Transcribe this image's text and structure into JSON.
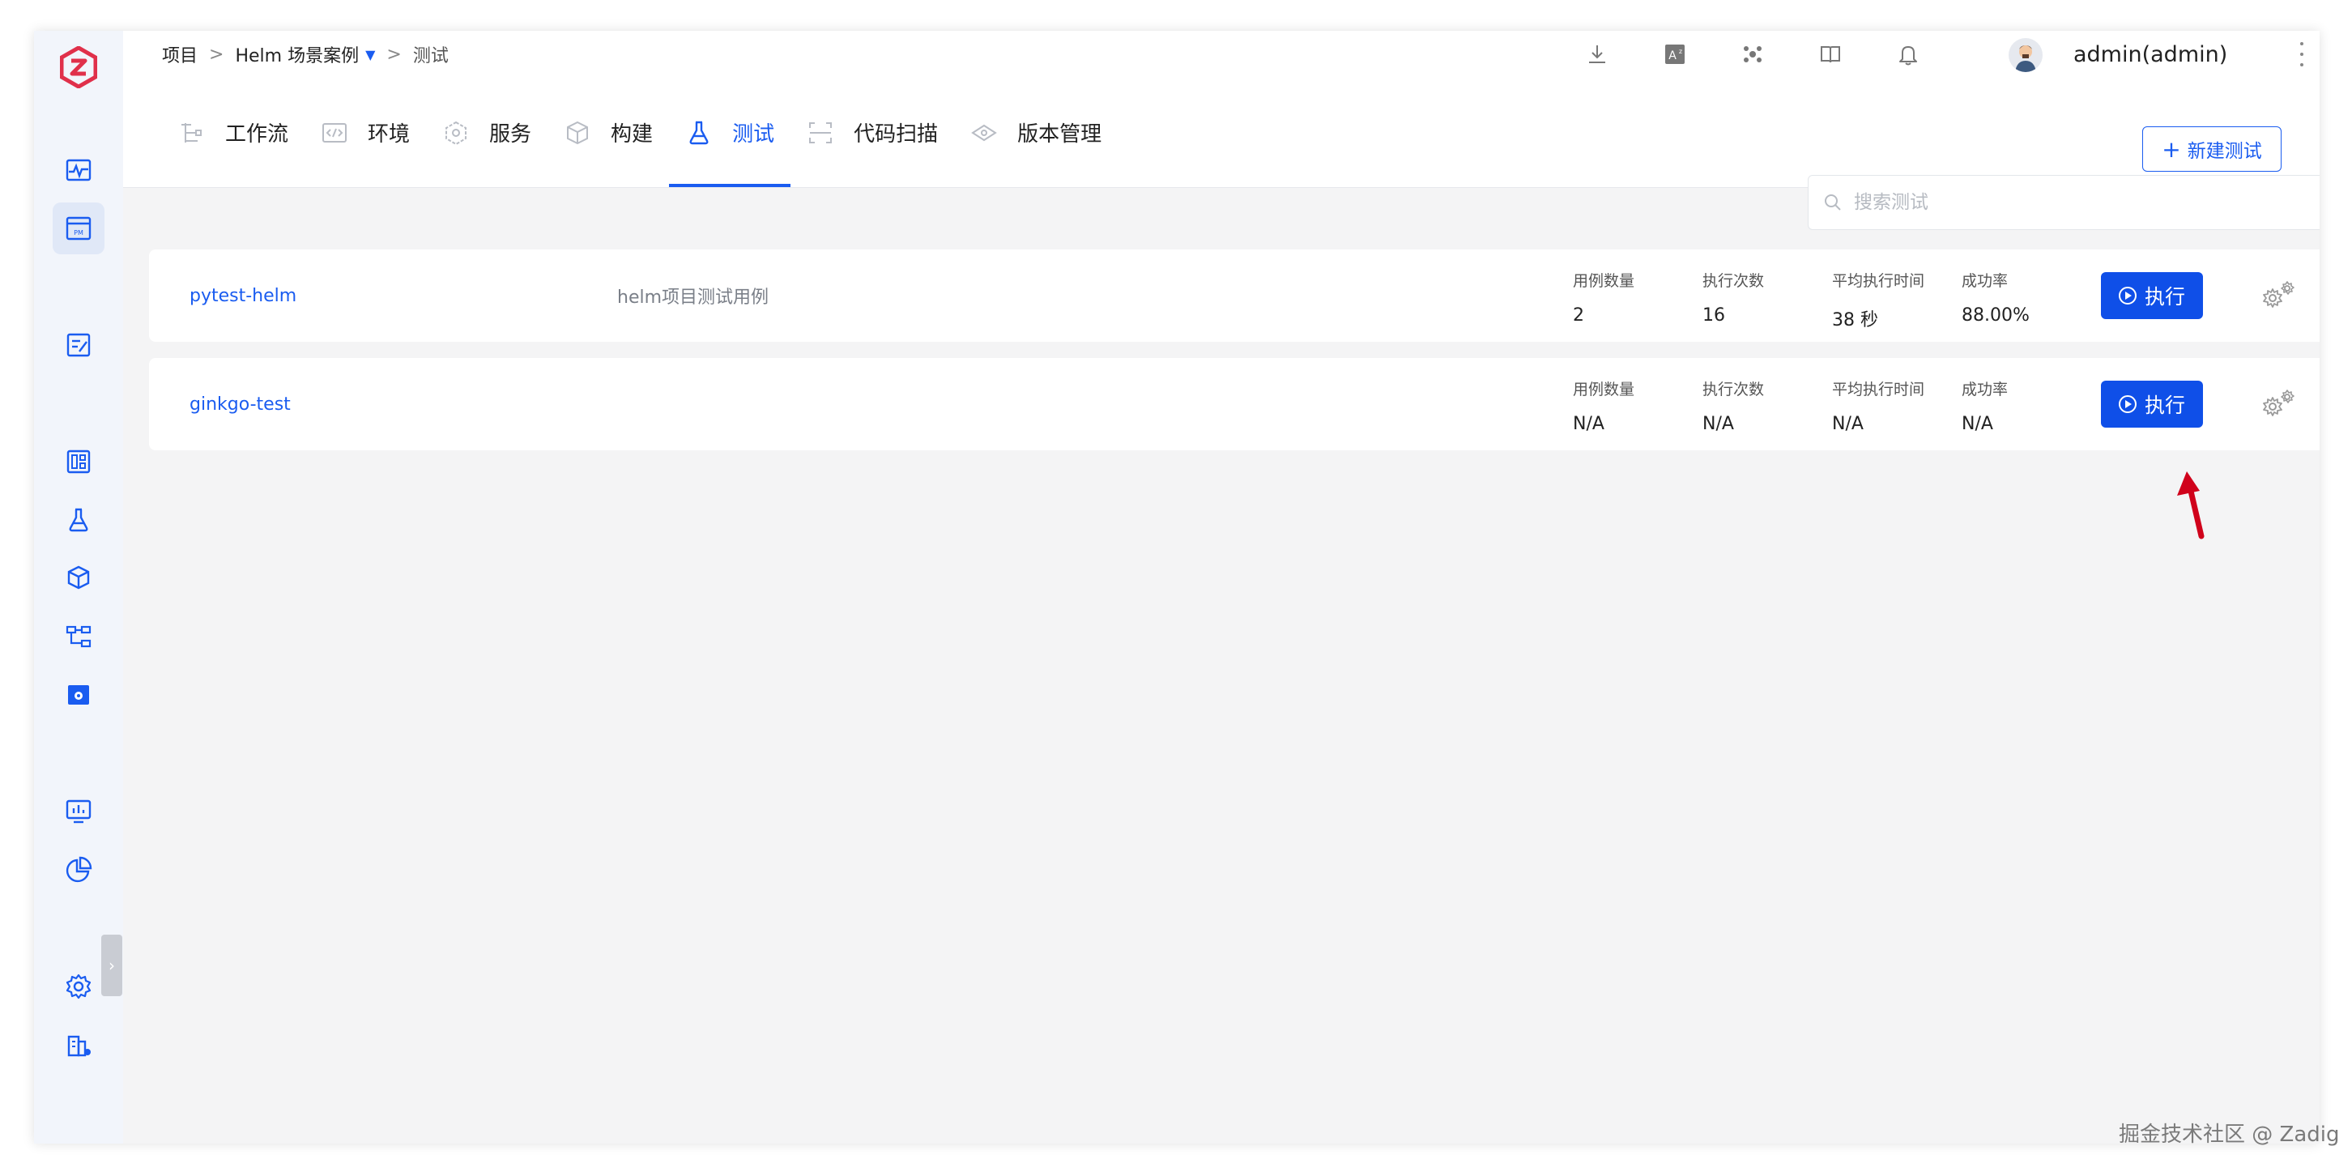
{
  "breadcrumb": {
    "root": "项目",
    "separator": ">",
    "project": "Helm 场景案例",
    "current": "测试"
  },
  "user": {
    "name": "admin(admin)"
  },
  "tabs": [
    {
      "label": "工作流",
      "icon": "workflow-icon"
    },
    {
      "label": "环境",
      "icon": "environment-icon"
    },
    {
      "label": "服务",
      "icon": "service-icon"
    },
    {
      "label": "构建",
      "icon": "build-icon"
    },
    {
      "label": "测试",
      "icon": "flask-icon",
      "active": true
    },
    {
      "label": "代码扫描",
      "icon": "scan-icon"
    },
    {
      "label": "版本管理",
      "icon": "version-icon"
    }
  ],
  "new_test_button": "新建测试",
  "search": {
    "placeholder": "搜索测试"
  },
  "stat_labels": {
    "cases": "用例数量",
    "runs": "执行次数",
    "avg_time": "平均执行时间",
    "success_rate": "成功率"
  },
  "tests": [
    {
      "name": "pytest-helm",
      "description": "helm项目测试用例",
      "cases": "2",
      "runs": "16",
      "avg_time": "38 秒",
      "success_rate": "88.00%",
      "run_label": "执行"
    },
    {
      "name": "ginkgo-test",
      "description": "",
      "cases": "N/A",
      "runs": "N/A",
      "avg_time": "N/A",
      "success_rate": "N/A",
      "run_label": "执行"
    }
  ],
  "watermark": "掘金技术社区 @ Zadig",
  "colors": {
    "accent": "#1a5cf0",
    "button": "#0f4fe8",
    "logo": "#e0304a",
    "arrow": "#d0021b"
  }
}
